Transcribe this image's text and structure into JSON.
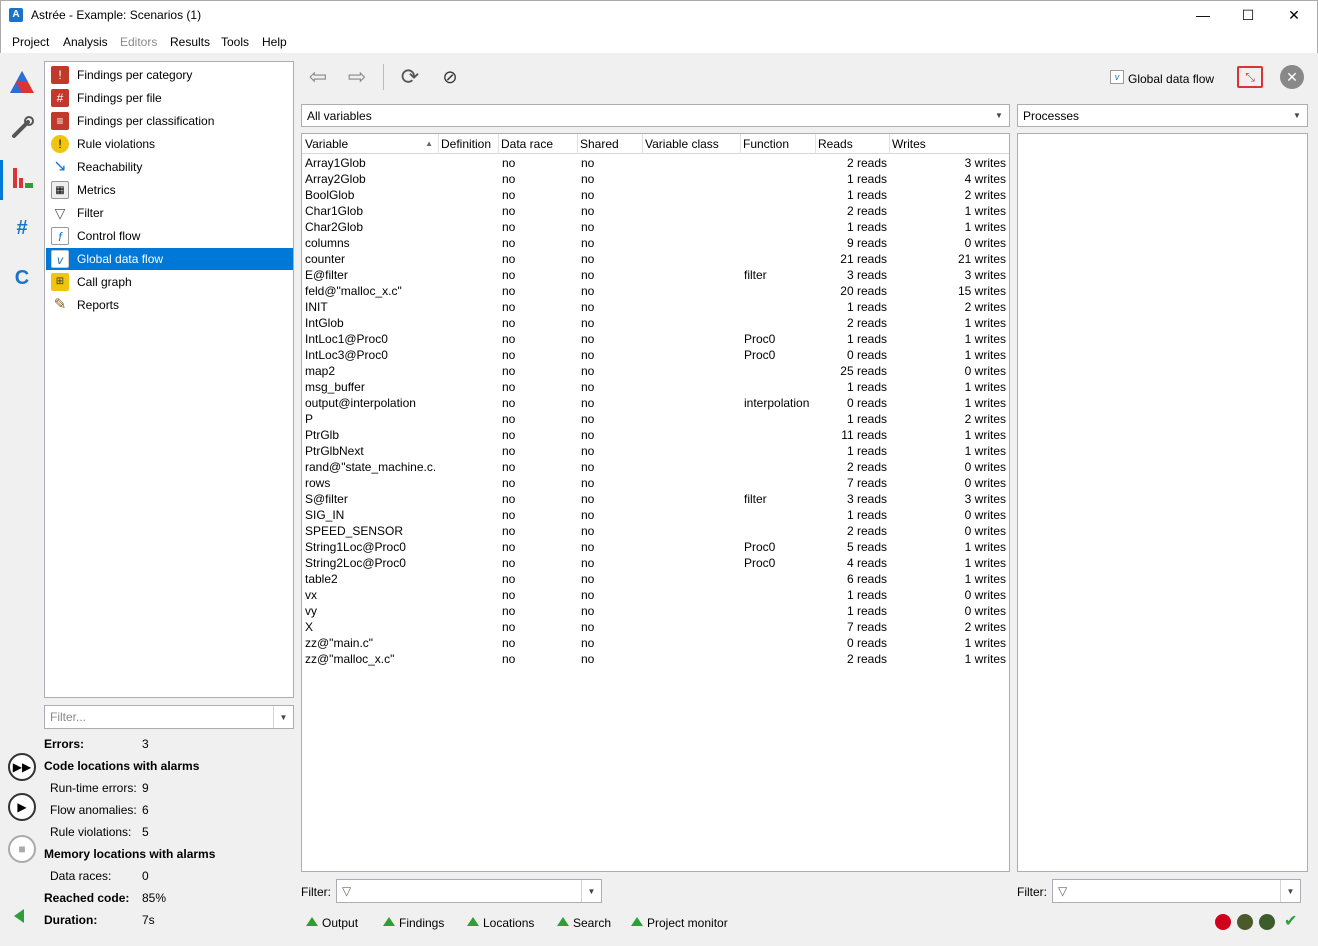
{
  "window": {
    "title": "Astrée - Example: Scenarios (1)",
    "app_icon": "astree-logo-icon",
    "controls": {
      "minimize": "—",
      "maximize": "☐",
      "close": "✕"
    }
  },
  "menubar": [
    {
      "label": "Project",
      "enabled": true
    },
    {
      "label": "Analysis",
      "enabled": true
    },
    {
      "label": "Editors",
      "enabled": false
    },
    {
      "label": "Results",
      "enabled": true
    },
    {
      "label": "Tools",
      "enabled": true
    },
    {
      "label": "Help",
      "enabled": true
    }
  ],
  "sidebar_icons": [
    "analysis-triangle-icon",
    "wrench-icon",
    "results-chart-icon",
    "hash-file-icon",
    "c-file-icon"
  ],
  "nav": {
    "items": [
      {
        "label": "Findings per category",
        "icon": "findings-category-icon"
      },
      {
        "label": "Findings per file",
        "icon": "findings-file-icon"
      },
      {
        "label": "Findings per classification",
        "icon": "findings-classification-icon"
      },
      {
        "label": "Rule violations",
        "icon": "rule-violations-icon"
      },
      {
        "label": "Reachability",
        "icon": "reachability-icon"
      },
      {
        "label": "Metrics",
        "icon": "metrics-icon"
      },
      {
        "label": "Filter",
        "icon": "filter-funnel-icon"
      },
      {
        "label": "Control flow",
        "icon": "control-flow-icon"
      },
      {
        "label": "Global data flow",
        "icon": "global-data-flow-icon",
        "selected": true
      },
      {
        "label": "Call graph",
        "icon": "call-graph-icon"
      },
      {
        "label": "Reports",
        "icon": "reports-pencil-icon"
      }
    ],
    "filter_placeholder": "Filter..."
  },
  "summary": {
    "errors_label": "Errors:",
    "errors_value": "3",
    "code_locations_label": "Code locations with alarms",
    "runtime_errors_label": "Run-time errors:",
    "runtime_errors_value": "9",
    "flow_anomalies_label": "Flow anomalies:",
    "flow_anomalies_value": "6",
    "rule_violations_label": "Rule violations:",
    "rule_violations_value": "5",
    "memory_locations_label": "Memory locations with alarms",
    "data_races_label": "Data races:",
    "data_races_value": "0",
    "reached_code_label": "Reached code:",
    "reached_code_value": "85%",
    "duration_label": "Duration:",
    "duration_value": "7s"
  },
  "toolbar": {
    "view_title": "Global data flow"
  },
  "variables_combo": "All variables",
  "processes_combo": "Processes",
  "table": {
    "columns": [
      "Variable",
      "Definition",
      "Data race",
      "Shared",
      "Variable class",
      "Function",
      "Reads",
      "Writes"
    ],
    "rows": [
      [
        "Array1Glob",
        "",
        "no",
        "no",
        "",
        "",
        "2 reads",
        "3 writes"
      ],
      [
        "Array2Glob",
        "",
        "no",
        "no",
        "",
        "",
        "1 reads",
        "4 writes"
      ],
      [
        "BoolGlob",
        "",
        "no",
        "no",
        "",
        "",
        "1 reads",
        "2 writes"
      ],
      [
        "Char1Glob",
        "",
        "no",
        "no",
        "",
        "",
        "2 reads",
        "1 writes"
      ],
      [
        "Char2Glob",
        "",
        "no",
        "no",
        "",
        "",
        "1 reads",
        "1 writes"
      ],
      [
        "columns",
        "",
        "no",
        "no",
        "",
        "",
        "9 reads",
        "0 writes"
      ],
      [
        "counter",
        "",
        "no",
        "no",
        "",
        "",
        "21 reads",
        "21 writes"
      ],
      [
        "E@filter",
        "",
        "no",
        "no",
        "",
        "filter",
        "3 reads",
        "3 writes"
      ],
      [
        "feld@\"malloc_x.c\"",
        "",
        "no",
        "no",
        "",
        "",
        "20 reads",
        "15 writes"
      ],
      [
        "INIT",
        "",
        "no",
        "no",
        "",
        "",
        "1 reads",
        "2 writes"
      ],
      [
        "IntGlob",
        "",
        "no",
        "no",
        "",
        "",
        "2 reads",
        "1 writes"
      ],
      [
        "IntLoc1@Proc0",
        "",
        "no",
        "no",
        "",
        "Proc0",
        "1 reads",
        "1 writes"
      ],
      [
        "IntLoc3@Proc0",
        "",
        "no",
        "no",
        "",
        "Proc0",
        "0 reads",
        "1 writes"
      ],
      [
        "map2",
        "",
        "no",
        "no",
        "",
        "",
        "25 reads",
        "0 writes"
      ],
      [
        "msg_buffer",
        "",
        "no",
        "no",
        "",
        "",
        "1 reads",
        "1 writes"
      ],
      [
        "output@interpolation",
        "",
        "no",
        "no",
        "",
        "interpolation",
        "0 reads",
        "1 writes"
      ],
      [
        "P",
        "",
        "no",
        "no",
        "",
        "",
        "1 reads",
        "2 writes"
      ],
      [
        "PtrGlb",
        "",
        "no",
        "no",
        "",
        "",
        "11 reads",
        "1 writes"
      ],
      [
        "PtrGlbNext",
        "",
        "no",
        "no",
        "",
        "",
        "1 reads",
        "1 writes"
      ],
      [
        "rand@\"state_machine.c...",
        "",
        "no",
        "no",
        "",
        "",
        "2 reads",
        "0 writes"
      ],
      [
        "rows",
        "",
        "no",
        "no",
        "",
        "",
        "7 reads",
        "0 writes"
      ],
      [
        "S@filter",
        "",
        "no",
        "no",
        "",
        "filter",
        "3 reads",
        "3 writes"
      ],
      [
        "SIG_IN",
        "",
        "no",
        "no",
        "",
        "",
        "1 reads",
        "0 writes"
      ],
      [
        "SPEED_SENSOR",
        "",
        "no",
        "no",
        "",
        "",
        "2 reads",
        "0 writes"
      ],
      [
        "String1Loc@Proc0",
        "",
        "no",
        "no",
        "",
        "Proc0",
        "5 reads",
        "1 writes"
      ],
      [
        "String2Loc@Proc0",
        "",
        "no",
        "no",
        "",
        "Proc0",
        "4 reads",
        "1 writes"
      ],
      [
        "table2",
        "",
        "no",
        "no",
        "",
        "",
        "6 reads",
        "1 writes"
      ],
      [
        "vx",
        "",
        "no",
        "no",
        "",
        "",
        "1 reads",
        "0 writes"
      ],
      [
        "vy",
        "",
        "no",
        "no",
        "",
        "",
        "1 reads",
        "0 writes"
      ],
      [
        "X",
        "",
        "no",
        "no",
        "",
        "",
        "7 reads",
        "2 writes"
      ],
      [
        "zz@\"main.c\"",
        "",
        "no",
        "no",
        "",
        "",
        "0 reads",
        "1 writes"
      ],
      [
        "zz@\"malloc_x.c\"",
        "",
        "no",
        "no",
        "",
        "",
        "2 reads",
        "1 writes"
      ]
    ]
  },
  "filters": {
    "main_label": "Filter:",
    "side_label": "Filter:"
  },
  "bottom_tabs": [
    "Output",
    "Findings",
    "Locations",
    "Search",
    "Project monitor"
  ],
  "status_leds": [
    {
      "name": "red-status-led",
      "color": "#d0021b"
    },
    {
      "name": "olive-status-led",
      "color": "#4a5a2a"
    },
    {
      "name": "dark-green-status-led",
      "color": "#3c5c2c"
    }
  ],
  "colors": {
    "selection": "#0078d7",
    "accent_green": "#2e9e3a"
  }
}
